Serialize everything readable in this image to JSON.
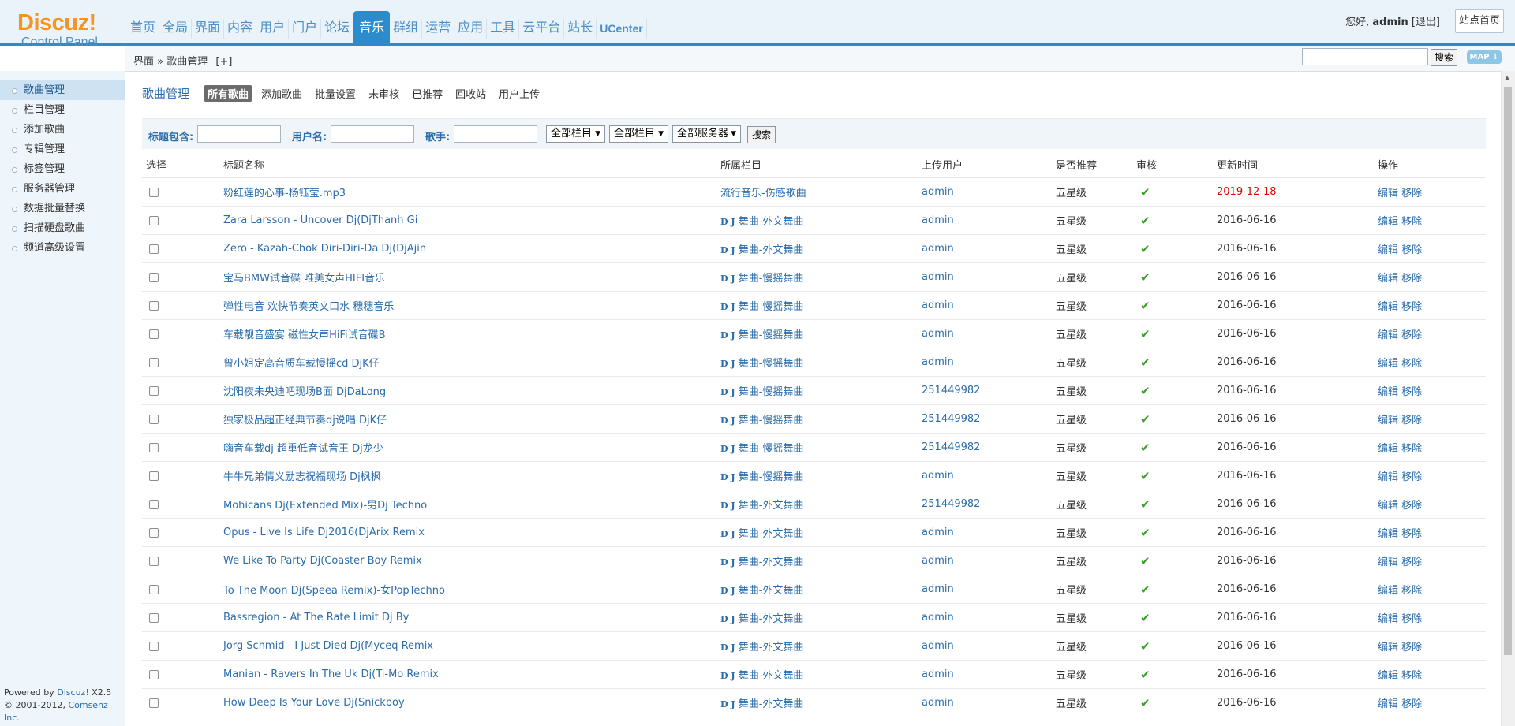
{
  "logo": {
    "word": "Discuz!",
    "sub": "Control Panel"
  },
  "nav": [
    {
      "label": "首页",
      "active": false
    },
    {
      "label": "全局",
      "active": false
    },
    {
      "label": "界面",
      "active": false
    },
    {
      "label": "内容",
      "active": false
    },
    {
      "label": "用户",
      "active": false
    },
    {
      "label": "门户",
      "active": false
    },
    {
      "label": "论坛",
      "active": false
    },
    {
      "label": "音乐",
      "active": true
    },
    {
      "label": "群组",
      "active": false
    },
    {
      "label": "运营",
      "active": false
    },
    {
      "label": "应用",
      "active": false
    },
    {
      "label": "工具",
      "active": false
    },
    {
      "label": "云平台",
      "active": false
    },
    {
      "label": "站长",
      "active": false
    },
    {
      "label": "UCenter",
      "active": false
    }
  ],
  "user": {
    "greeting": "您好,",
    "name": "admin",
    "logout": "[退出]",
    "site_home": "站点首页"
  },
  "breadcrumb": {
    "section": "界面",
    "sep": " » ",
    "page": "歌曲管理",
    "plus": "[+]"
  },
  "top_search": {
    "button": "搜索",
    "map": "MAP ↓"
  },
  "sidebar": [
    {
      "label": "歌曲管理",
      "active": true
    },
    {
      "label": "栏目管理",
      "active": false
    },
    {
      "label": "添加歌曲",
      "active": false
    },
    {
      "label": "专辑管理",
      "active": false
    },
    {
      "label": "标签管理",
      "active": false
    },
    {
      "label": "服务器管理",
      "active": false
    },
    {
      "label": "数据批量替换",
      "active": false
    },
    {
      "label": "扫描硬盘歌曲",
      "active": false
    },
    {
      "label": "频道高级设置",
      "active": false
    }
  ],
  "footer": {
    "powered": "Powered by",
    "brand": "Discuz!",
    "version": "X2.5",
    "copy": "© 2001-2012,",
    "company": "Comsenz Inc."
  },
  "subhead": {
    "title": "歌曲管理",
    "tabs": [
      {
        "label": "所有歌曲",
        "active": true
      },
      {
        "label": "添加歌曲",
        "active": false
      },
      {
        "label": "批量设置",
        "active": false
      },
      {
        "label": "未审核",
        "active": false
      },
      {
        "label": "已推荐",
        "active": false
      },
      {
        "label": "回收站",
        "active": false
      },
      {
        "label": "用户上传",
        "active": false
      }
    ]
  },
  "filter": {
    "title_label": "标题包含:",
    "user_label": "用户名:",
    "singer_label": "歌手:",
    "title_value": "",
    "user_value": "",
    "singer_value": "",
    "select1": "全部栏目",
    "select2": "全部栏目",
    "select3": "全部服务器",
    "search": "搜索"
  },
  "table": {
    "headers": [
      "选择",
      "标题名称",
      "所属栏目",
      "上传用户",
      "是否推荐",
      "审核",
      "更新时间",
      "操作"
    ],
    "rows": [
      {
        "title": "粉红莲的心事-杨钰莹.mp3",
        "cat_prefix": "",
        "category": "流行音乐-伤感歌曲",
        "user": "admin",
        "rec": "五星级",
        "date": "2019-12-18",
        "date_red": true
      },
      {
        "title": "Zara Larsson - Uncover Dj(DjThanh Gi",
        "cat_prefix": "D J",
        "category": "舞曲-外文舞曲",
        "user": "admin",
        "rec": "五星级",
        "date": "2016-06-16",
        "date_red": false
      },
      {
        "title": "Zero - Kazah-Chok Diri-Diri-Da Dj(DjAjin",
        "cat_prefix": "D J",
        "category": "舞曲-外文舞曲",
        "user": "admin",
        "rec": "五星级",
        "date": "2016-06-16",
        "date_red": false
      },
      {
        "title": "宝马BMW试音碟 唯美女声HIFI音乐",
        "cat_prefix": "D J",
        "category": "舞曲-慢摇舞曲",
        "user": "admin",
        "rec": "五星级",
        "date": "2016-06-16",
        "date_red": false
      },
      {
        "title": "弹性电音 欢快节奏英文口水 穗穗音乐",
        "cat_prefix": "D J",
        "category": "舞曲-慢摇舞曲",
        "user": "admin",
        "rec": "五星级",
        "date": "2016-06-16",
        "date_red": false
      },
      {
        "title": "车载靓音盛宴 磁性女声HiFi试音碟B",
        "cat_prefix": "D J",
        "category": "舞曲-慢摇舞曲",
        "user": "admin",
        "rec": "五星级",
        "date": "2016-06-16",
        "date_red": false
      },
      {
        "title": "曾小姐定高音质车载慢摇cd DjK仔",
        "cat_prefix": "D J",
        "category": "舞曲-慢摇舞曲",
        "user": "admin",
        "rec": "五星级",
        "date": "2016-06-16",
        "date_red": false
      },
      {
        "title": "沈阳夜未央迪吧现场B面 DjDaLong",
        "cat_prefix": "D J",
        "category": "舞曲-慢摇舞曲",
        "user": "251449982",
        "rec": "五星级",
        "date": "2016-06-16",
        "date_red": false
      },
      {
        "title": "独家极品超正经典节奏dj说唱 DjK仔",
        "cat_prefix": "D J",
        "category": "舞曲-慢摇舞曲",
        "user": "251449982",
        "rec": "五星级",
        "date": "2016-06-16",
        "date_red": false
      },
      {
        "title": "嗨音车载dj 超重低音试音王 Dj龙少",
        "cat_prefix": "D J",
        "category": "舞曲-慢摇舞曲",
        "user": "251449982",
        "rec": "五星级",
        "date": "2016-06-16",
        "date_red": false
      },
      {
        "title": "牛牛兄弟情义励志祝福现场 Dj枫枫",
        "cat_prefix": "D J",
        "category": "舞曲-慢摇舞曲",
        "user": "admin",
        "rec": "五星级",
        "date": "2016-06-16",
        "date_red": false
      },
      {
        "title": "Mohicans Dj(Extended Mix)-男Dj Techno",
        "cat_prefix": "D J",
        "category": "舞曲-外文舞曲",
        "user": "251449982",
        "rec": "五星级",
        "date": "2016-06-16",
        "date_red": false
      },
      {
        "title": "Opus - Live Is Life Dj2016(DjArix Remix",
        "cat_prefix": "D J",
        "category": "舞曲-外文舞曲",
        "user": "admin",
        "rec": "五星级",
        "date": "2016-06-16",
        "date_red": false
      },
      {
        "title": "We Like To Party Dj(Coaster Boy Remix",
        "cat_prefix": "D J",
        "category": "舞曲-外文舞曲",
        "user": "admin",
        "rec": "五星级",
        "date": "2016-06-16",
        "date_red": false
      },
      {
        "title": "To The Moon Dj(Speea Remix)-女PopTechno",
        "cat_prefix": "D J",
        "category": "舞曲-外文舞曲",
        "user": "admin",
        "rec": "五星级",
        "date": "2016-06-16",
        "date_red": false
      },
      {
        "title": "Bassregion - At The Rate Limit Dj By",
        "cat_prefix": "D J",
        "category": "舞曲-外文舞曲",
        "user": "admin",
        "rec": "五星级",
        "date": "2016-06-16",
        "date_red": false
      },
      {
        "title": "Jorg Schmid - I Just Died Dj(Myceq Remix",
        "cat_prefix": "D J",
        "category": "舞曲-外文舞曲",
        "user": "admin",
        "rec": "五星级",
        "date": "2016-06-16",
        "date_red": false
      },
      {
        "title": "Manian - Ravers In The Uk Dj(Ti-Mo Remix",
        "cat_prefix": "D J",
        "category": "舞曲-外文舞曲",
        "user": "admin",
        "rec": "五星级",
        "date": "2016-06-16",
        "date_red": false
      },
      {
        "title": "How Deep Is Your Love Dj(Snickboy",
        "cat_prefix": "D J",
        "category": "舞曲-外文舞曲",
        "user": "admin",
        "rec": "五星级",
        "date": "2016-06-16",
        "date_red": false
      }
    ],
    "op_edit": "编辑",
    "op_remove": "移除"
  },
  "colors": {
    "accent": "#2b8bcd",
    "link": "#2b6cab",
    "logo": "#f7941e",
    "date_red": "#e60000",
    "check": "#3a9c2a"
  },
  "icons": {
    "approved": "check-icon",
    "map": "map-icon"
  }
}
